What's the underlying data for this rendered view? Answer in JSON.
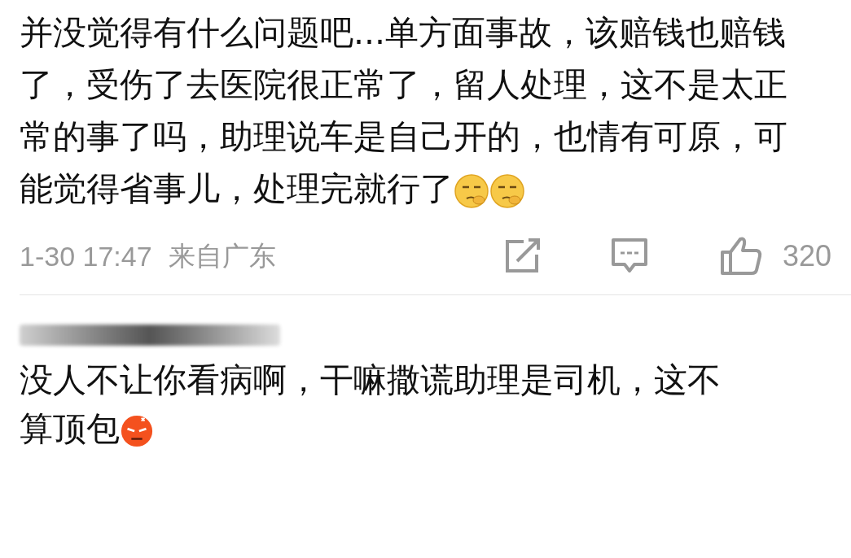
{
  "post": {
    "text": "并没觉得有什么问题吧...单方面事故，该赔钱也赔钱了，受伤了去医院很正常了，留人处理，这不是太正常的事了吗，助理说车是自己开的，也情有可原，可能觉得省事儿，处理完就行了",
    "emojis": [
      {
        "kind": "thinking"
      },
      {
        "kind": "thinking"
      }
    ],
    "time": "1-30 17:47",
    "location": "来自广东",
    "likes": "320"
  },
  "reply": {
    "text": "没人不让你看病啊，干嘛撒谎助理是司机，这不算顶包",
    "emojis": [
      {
        "kind": "angry"
      }
    ]
  }
}
